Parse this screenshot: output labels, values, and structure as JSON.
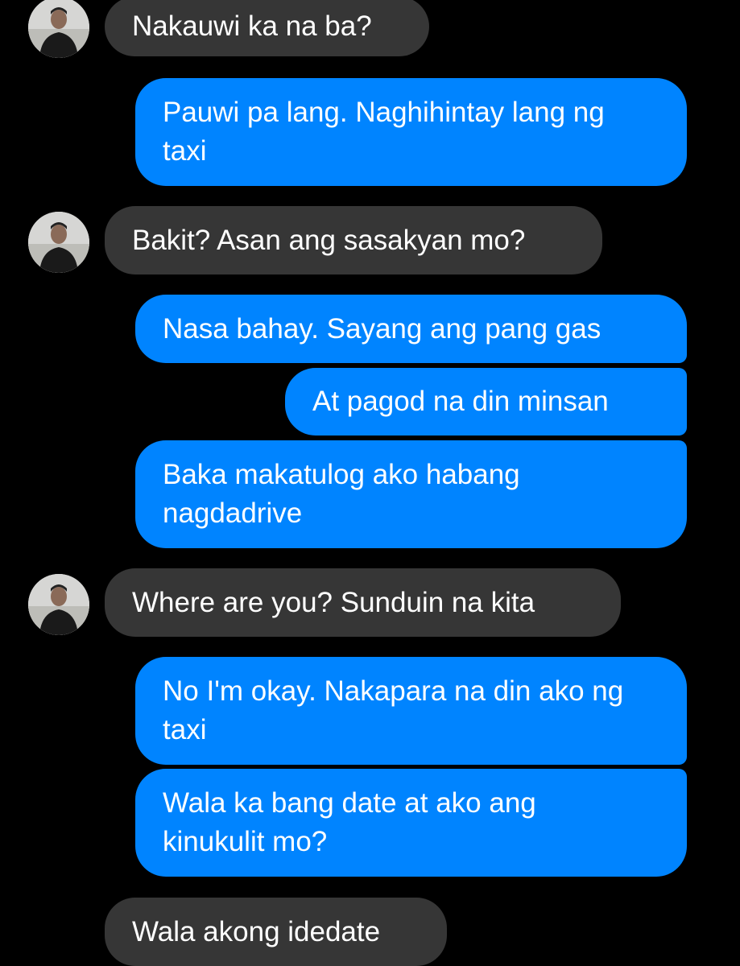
{
  "colors": {
    "background": "#000000",
    "sent_bubble": "#0084ff",
    "received_bubble": "#363636",
    "text": "#ffffff"
  },
  "messages": [
    {
      "from": "contact",
      "text": "Nakauwi ka na ba?"
    },
    {
      "from": "me",
      "text": "Pauwi pa lang. Naghihintay lang ng taxi"
    },
    {
      "from": "contact",
      "text": "Bakit? Asan ang sasakyan mo?"
    },
    {
      "from": "me",
      "text": "Nasa bahay. Sayang ang pang gas"
    },
    {
      "from": "me",
      "text": "At pagod na din minsan"
    },
    {
      "from": "me",
      "text": "Baka makatulog ako habang nagdadrive"
    },
    {
      "from": "contact",
      "text": "Where are you? Sunduin na kita"
    },
    {
      "from": "me",
      "text": "No I'm okay. Nakapara na din ako ng taxi"
    },
    {
      "from": "me",
      "text": "Wala ka bang date at ako ang kinukulit mo?"
    },
    {
      "from": "contact",
      "text": "Wala akong idedate"
    }
  ]
}
